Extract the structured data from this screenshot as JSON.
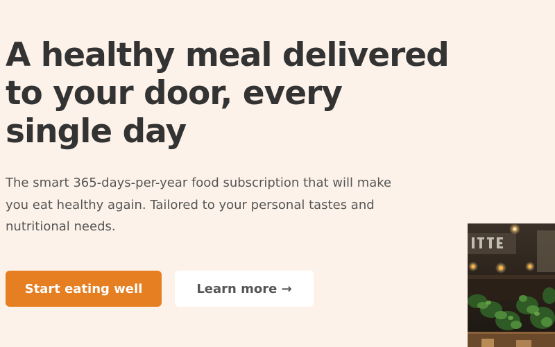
{
  "hero": {
    "title": "A healthy meal delivered to your door, every single day",
    "description": "The smart 365-days-per-year food subscription that will make you eat healthy again. Tailored to your personal tastes and nutritional needs.",
    "primary_button_label": "Start eating well",
    "secondary_button_label": "Learn more →",
    "image_alt": "Restaurant interior with plants"
  },
  "colors": {
    "background": "#fdf2e9",
    "primary_button": "#e67e22",
    "secondary_button": "#ffffff",
    "title_text": "#333333",
    "body_text": "#555555"
  }
}
